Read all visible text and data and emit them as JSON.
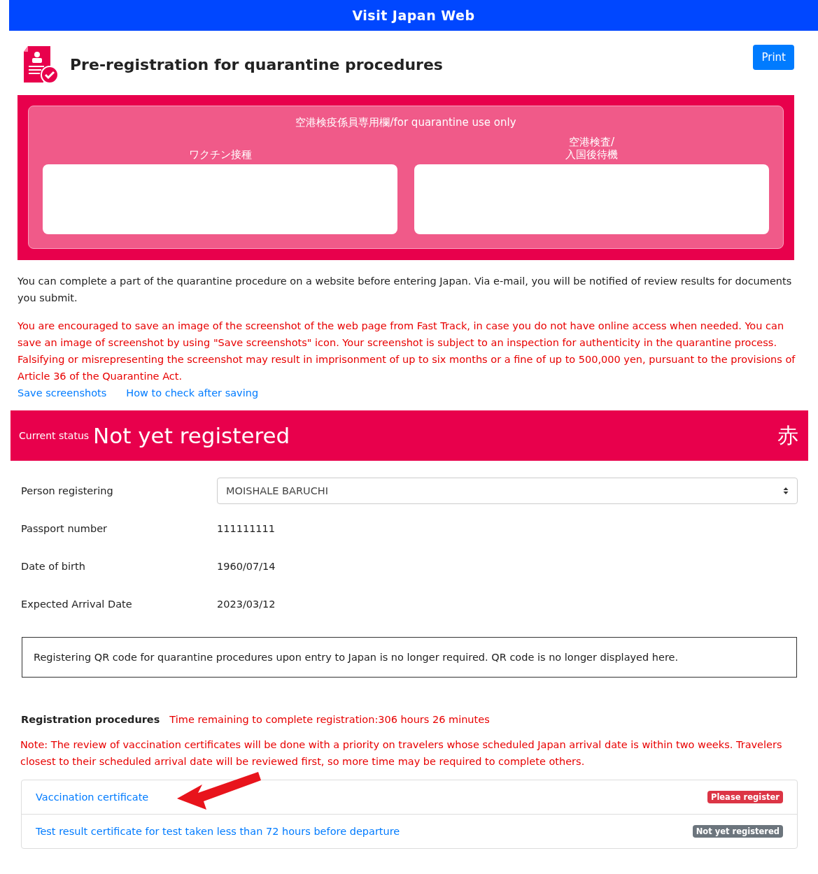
{
  "header": {
    "title": "Visit Japan Web"
  },
  "page": {
    "title": "Pre-registration for quarantine procedures",
    "print_button": "Print"
  },
  "quarantine_panel": {
    "title": "空港検疫係員専用欄/for quarantine use only",
    "columns": [
      "ワクチン接種",
      "空港検査/\n入国後待機"
    ]
  },
  "intro": "You can complete a part of the quarantine procedure on a website before entering Japan. Via e-mail, you will be notified of review results for documents you submit.",
  "warning": "You are encouraged to save an image of the screenshot of the web page from Fast Track, in case you do not have online access when needed. You can save an image of screenshot by using \"Save screenshots\" icon. Your screenshot is subject to an inspection for authenticity in the quarantine process. Falsifying or misrepresenting the screenshot may result in imprisonment of up to six months or a fine of up to 500,000 yen, pursuant to the provisions of Article 36 of the Quarantine Act.",
  "links": [
    "Save screenshots",
    "How to check after saving"
  ],
  "status": {
    "label": "Current status",
    "value": "Not yet registered",
    "mark": "赤"
  },
  "details": [
    {
      "label": "Person registering",
      "kind": "select",
      "value": "MOISHALE BARUCHI"
    },
    {
      "label": "Passport number",
      "kind": "text",
      "value": "111111111"
    },
    {
      "label": "Date of birth",
      "kind": "text",
      "value": "1960/07/14"
    },
    {
      "label": "Expected Arrival Date",
      "kind": "text",
      "value": "2023/03/12"
    }
  ],
  "notice": "Registering QR code for quarantine procedures upon entry to Japan is no longer required. QR code is no longer displayed here.",
  "registration": {
    "title": "Registration procedures",
    "time_remaining": "Time remaining to complete registration:306 hours 26 minutes",
    "note": "Note: The review of vaccination certificates will be done with a priority on travelers whose scheduled Japan arrival date is within two weeks. Travelers closest to their scheduled arrival date will be reviewed first, so more time may be required to complete others.",
    "items": [
      {
        "label": "Vaccination certificate",
        "badge": "Please register",
        "color": "#dc3545"
      },
      {
        "label": "Test result certificate for test taken less than 72 hours before departure",
        "badge": "Not yet registered",
        "color": "#6c757d"
      }
    ]
  }
}
